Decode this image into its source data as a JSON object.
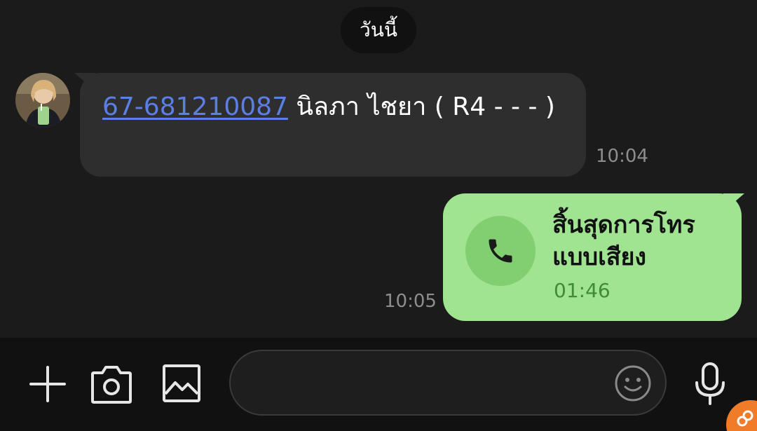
{
  "date_chip": "วันนี้",
  "incoming": {
    "phone": "67-681210087",
    "text": " นิลภา ไชยา ( R4 - - - )",
    "time": "10:04"
  },
  "outgoing": {
    "call_title": "สิ้นสุดการโทรแบบเสียง",
    "duration": "01:46",
    "time": "10:05"
  },
  "input": {
    "value": "",
    "placeholder": ""
  },
  "icons": {
    "plus": "plus-icon",
    "camera": "camera-icon",
    "gallery": "image-icon",
    "emoji": "smiley-icon",
    "mic": "microphone-icon",
    "call": "phone-icon"
  },
  "colors": {
    "background": "#1b1b1b",
    "incoming_bubble": "#2e2e2e",
    "outgoing_bubble": "#a0e391",
    "link": "#5b7fe6",
    "accent_orange": "#f07c2a"
  }
}
